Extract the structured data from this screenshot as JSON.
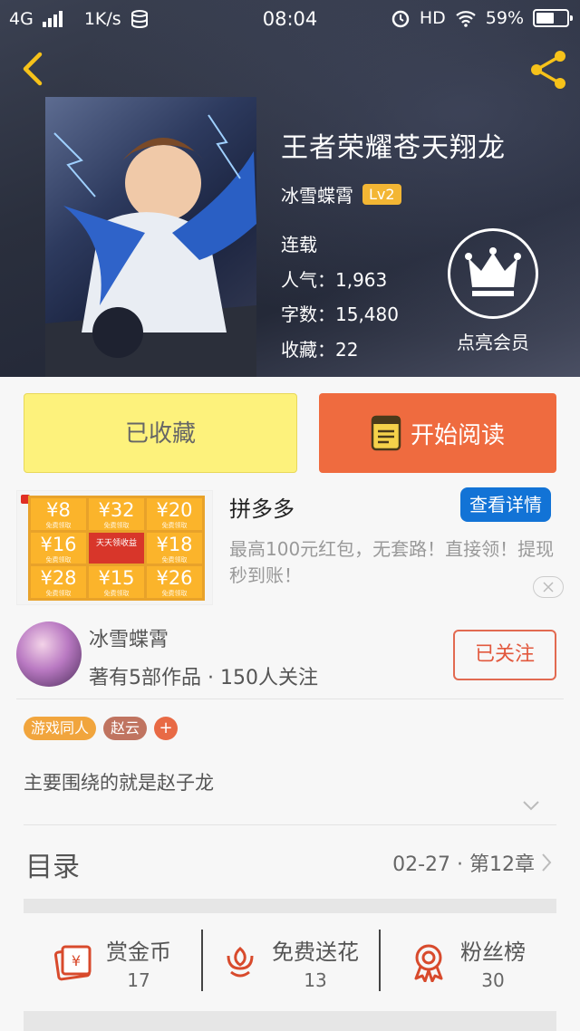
{
  "status_bar": {
    "network": "4G",
    "speed": "1K/s",
    "time": "08:04",
    "hd": "HD",
    "battery": "59%",
    "battery_level": 0.59
  },
  "book": {
    "title": "王者荣耀苍天翔龙",
    "author": "冰雪蝶霄",
    "level": "Lv2",
    "status": "连载",
    "popularity_label": "人气：",
    "popularity": "1,963",
    "words_label": "字数：",
    "words": "15,480",
    "favorites_label": "收藏：",
    "favorites": "22",
    "member_label": "点亮会员"
  },
  "actions": {
    "favorited_label": "已收藏",
    "read_label": "开始阅读"
  },
  "ad": {
    "brand": "拼多多",
    "detail_button": "查看详情",
    "description": "最高100元红包，无套路！直接领！提现秒到账！",
    "grid": [
      {
        "amount": "¥8",
        "sub": "免费领取"
      },
      {
        "amount": "¥32",
        "sub": "免费领取"
      },
      {
        "amount": "¥20",
        "sub": "免费领取"
      },
      {
        "amount": "¥16",
        "sub": "免费领取"
      },
      {
        "amount": "天天领收益",
        "sub": ""
      },
      {
        "amount": "¥18",
        "sub": "免费领取"
      },
      {
        "amount": "¥28",
        "sub": "免费领取"
      },
      {
        "amount": "¥15",
        "sub": "免费领取"
      },
      {
        "amount": "¥26",
        "sub": "免费领取"
      }
    ]
  },
  "author_card": {
    "name": "冰雪蝶霄",
    "stats": "著有5部作品 · 150人关注",
    "follow_label": "已关注"
  },
  "tags": [
    "游戏同人",
    "赵云",
    "+"
  ],
  "synopsis": "主要围绕的就是赵子龙",
  "toc": {
    "title": "目录",
    "latest": "02-27 · 第12章"
  },
  "stats": [
    {
      "label": "赏金币",
      "value": "17",
      "icon": "reward-coin-icon"
    },
    {
      "label": "免费送花",
      "value": "13",
      "icon": "flower-icon"
    },
    {
      "label": "粉丝榜",
      "value": "30",
      "icon": "medal-icon"
    }
  ],
  "colors": {
    "accent_orange": "#ef6b3f",
    "favorite_yellow": "#fdf27c",
    "level_badge": "#f3b634",
    "ad_blue": "#1273d6",
    "icon_red": "#d84a2c"
  }
}
